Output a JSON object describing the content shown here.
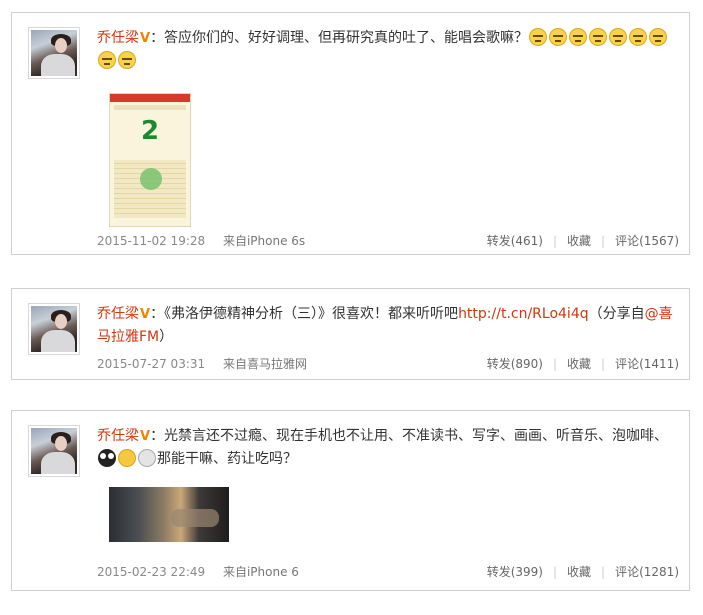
{
  "posts": [
    {
      "username": "乔任梁",
      "verified_icon": "v-verified-icon",
      "text_before": "：答应你们的、好好调理、但再研究真的吐了、能唱会歌嘛？",
      "emoji_count": 9,
      "image": "lottery-thumbnail",
      "image_number": "2",
      "time": "2015-11-02 19:28",
      "source": "来自iPhone 6s",
      "repost": "转发(461)",
      "favorite": "收藏",
      "comment": "评论(1567)"
    },
    {
      "username": "乔任梁",
      "verified_icon": "v-verified-icon",
      "text_before": "：《弗洛伊德精神分析（三）》很喜欢！都来听听吧",
      "link": "http://t.cn/RLo4i4q",
      "text_middle": "（分享自",
      "mention": "@喜马拉雅FM",
      "text_after": "）",
      "time": "2015-07-27 03:31",
      "source": "来自喜马拉雅网",
      "repost": "转发(890)",
      "favorite": "收藏",
      "comment": "评论(1411)"
    },
    {
      "username": "乔任梁",
      "verified_icon": "v-verified-icon",
      "text_before": "：光禁言还不过瘾、现在手机也不让用、不准读书、写字、画画、听音乐、泡咖啡、",
      "text_after": "那能干嘛、药让吃吗？",
      "image": "photo-thumbnail",
      "time": "2015-02-23 22:49",
      "source": "来自iPhone 6",
      "repost": "转发(399)",
      "favorite": "收藏",
      "comment": "评论(1281)"
    }
  ],
  "colors": {
    "username": "#d4350c",
    "link": "#d4350c",
    "verified": "#f08300",
    "border": "#d0d0d0",
    "meta": "#666666"
  }
}
